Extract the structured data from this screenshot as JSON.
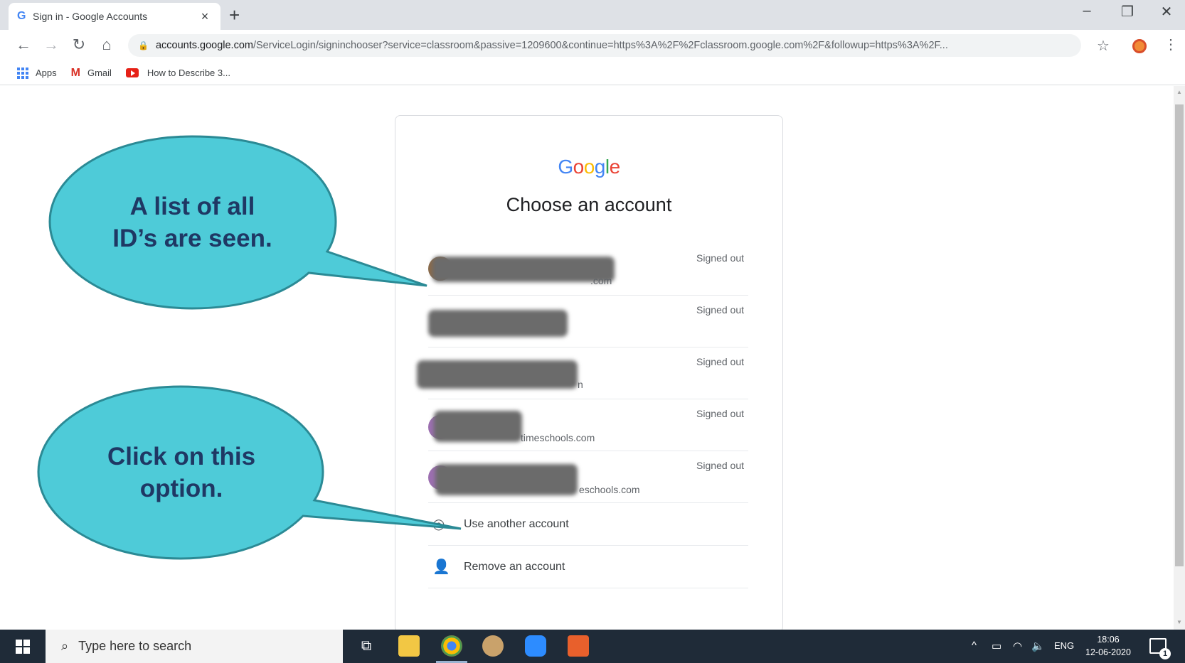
{
  "browser": {
    "tab_title": "Sign in - Google Accounts",
    "tab_favicon": "G",
    "tab_close": "×",
    "new_tab": "+",
    "url_host": "accounts.google.com",
    "url_path": "/ServiceLogin/signinchooser?service=classroom&passive=1209600&continue=https%3A%2F%2Fclassroom.google.com%2F&followup=https%3A%2F...",
    "bookmarks": [
      "Apps",
      "Gmail",
      "How to Describe 3..."
    ],
    "window_controls": [
      "–",
      "❐",
      "✕"
    ]
  },
  "signin": {
    "logo_letters": [
      "G",
      "o",
      "o",
      "g",
      "l",
      "e"
    ],
    "title": "Choose an account",
    "accounts": [
      {
        "status": "Signed out",
        "email_tail": ".com"
      },
      {
        "status": "Signed out",
        "email_tail": ""
      },
      {
        "status": "Signed out",
        "email_tail": "n"
      },
      {
        "status": "Signed out",
        "email_tail": "timeschools.com"
      },
      {
        "status": "Signed out",
        "email_tail": "eschools.com"
      }
    ],
    "use_another": "Use another account",
    "remove": "Remove an account"
  },
  "callouts": {
    "top": [
      "A list of all",
      "ID’s are seen."
    ],
    "bottom": [
      "Click on this",
      "option."
    ],
    "fill": "#4ecbd8",
    "stroke": "#2b8a95"
  },
  "taskbar": {
    "search_placeholder": "Type here to search",
    "tray_lang": "ENG",
    "time": "18:06",
    "date": "12-06-2020",
    "notif_count": "1"
  }
}
